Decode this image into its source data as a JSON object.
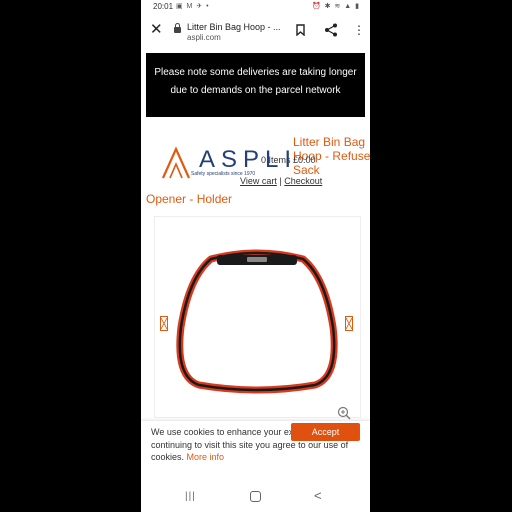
{
  "status_bar": {
    "time": "20:01",
    "left_icons": "▣ M ✈ •",
    "right_icons": "⏰ ✱ ≋ ▲ ▮"
  },
  "tab_bar": {
    "title": "Litter Bin Bag Hoop - ...",
    "url": "aspli.com",
    "close_glyph": "✕",
    "menu_glyph": "⋮"
  },
  "notice": {
    "text": "Please note some deliveries are taking longer due to demands on the parcel network"
  },
  "header": {
    "logo_word": "ASPLI",
    "logo_tagline": "Safety specialists since 1970",
    "cart_items": "0 Items £0.00",
    "view_cart": "View cart",
    "separator": "|",
    "checkout": "Checkout"
  },
  "product": {
    "title_part1": "Litter Bin Bag Hoop - Refuse Sack",
    "title_part2": "Opener - Holder"
  },
  "cookie": {
    "text": "We use cookies to enhance your experience. By continuing to visit this site you agree to our use of cookies.",
    "more_info": "More info",
    "accept_label": "Accept"
  },
  "navbar": {
    "recent_glyph": "|||",
    "back_glyph": "<"
  },
  "colors": {
    "brand_orange": "#e05a10",
    "logo_blue": "#23407a",
    "hoop_red": "#d93a1e"
  }
}
